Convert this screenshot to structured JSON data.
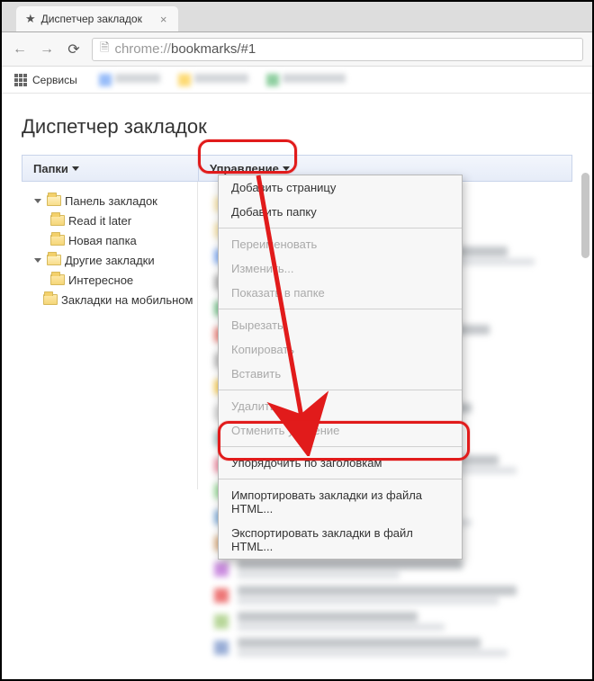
{
  "tab": {
    "title": "Диспетчер закладок"
  },
  "url": {
    "prefix": "chrome://",
    "path": "bookmarks/#1"
  },
  "bookmarksBar": {
    "apps": "Сервисы"
  },
  "page": {
    "title": "Диспетчер закладок"
  },
  "headers": {
    "folders": "Папки",
    "manage": "Управление"
  },
  "tree": {
    "bookmarksPanel": "Панель закладок",
    "readLater": "Read it later",
    "newFolder": "Новая папка",
    "otherBookmarks": "Другие закладки",
    "interesting": "Интересное",
    "mobileBookmarks": "Закладки на мобильном"
  },
  "menu": {
    "addPage": "Добавить страницу",
    "addFolder": "Добавить папку",
    "rename": "Переименовать",
    "edit": "Изменить...",
    "showInFolder": "Показать в папке",
    "cut": "Вырезать",
    "copy": "Копировать",
    "paste": "Вставить",
    "delete": "Удалить",
    "undoDelete": "Отменить удаление",
    "sortByTitle": "Упорядочить по заголовкам",
    "importHtml": "Импортировать закладки из файла HTML...",
    "exportHtml": "Экспортировать закладки в файл HTML..."
  }
}
